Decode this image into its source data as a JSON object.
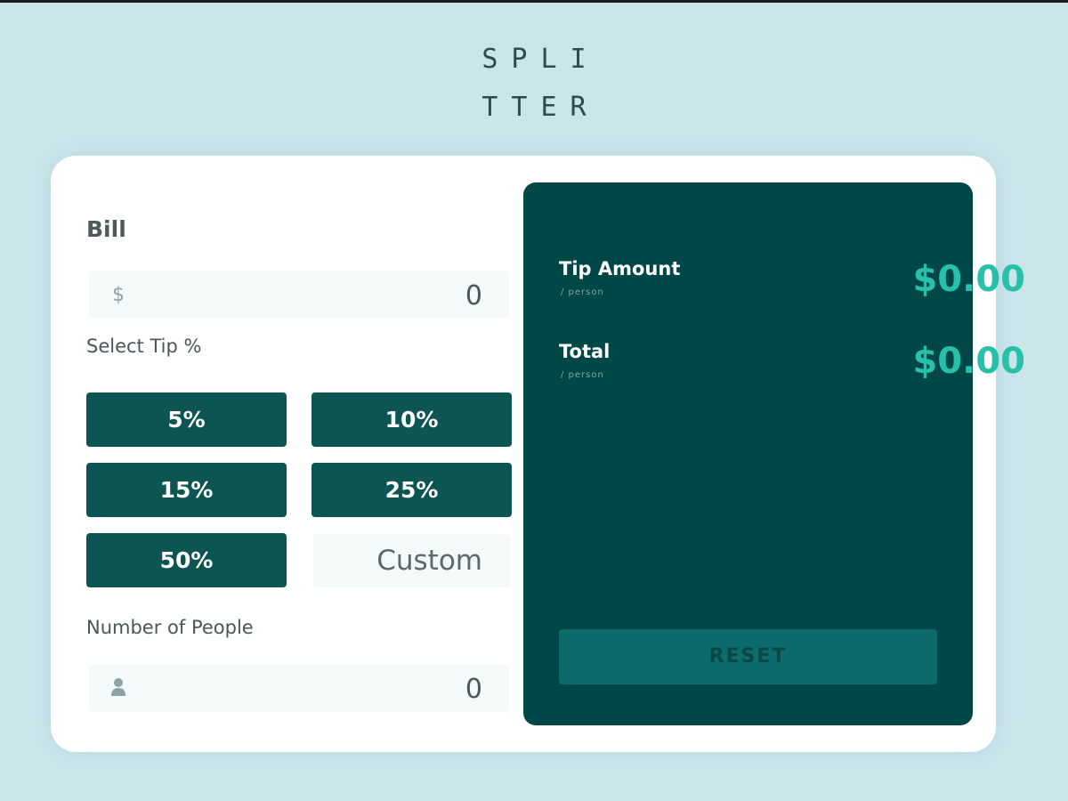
{
  "app": {
    "logo_line1": "SPLI",
    "logo_line2": "TTER"
  },
  "bill": {
    "label": "Bill",
    "currency_icon": "dollar-icon",
    "value": "0"
  },
  "tip": {
    "label": "Select Tip %",
    "options": [
      "5%",
      "10%",
      "15%",
      "25%",
      "50%"
    ],
    "custom_placeholder": "Custom"
  },
  "people": {
    "label": "Number of People",
    "icon": "person-icon",
    "value": "0"
  },
  "results": {
    "tip_amount": {
      "label": "Tip Amount",
      "sublabel": "/ person",
      "value": "$0.00"
    },
    "total": {
      "label": "Total",
      "sublabel": "/ person",
      "value": "$0.00"
    },
    "reset_label": "RESET"
  },
  "colors": {
    "background": "#c9e5ea",
    "accent": "#004747",
    "button": "#0c5553",
    "amount": "#26c0ab",
    "reset": "#0d6b6b"
  }
}
